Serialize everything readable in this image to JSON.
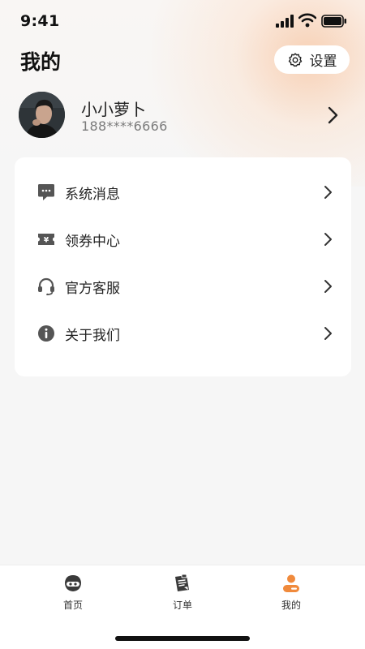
{
  "status_bar": {
    "time": "9:41"
  },
  "header": {
    "title": "我的",
    "settings_label": "设置"
  },
  "profile": {
    "name": "小小萝卜",
    "phone": "188****6666"
  },
  "menu": [
    {
      "label": "系统消息",
      "icon": "message-icon"
    },
    {
      "label": "领券中心",
      "icon": "coupon-icon"
    },
    {
      "label": "官方客服",
      "icon": "headset-icon"
    },
    {
      "label": "关于我们",
      "icon": "info-icon"
    }
  ],
  "tabs": [
    {
      "label": "首页",
      "icon": "home-mascot-icon",
      "active": false
    },
    {
      "label": "订单",
      "icon": "order-icon",
      "active": false
    },
    {
      "label": "我的",
      "icon": "profile-icon",
      "active": true
    }
  ],
  "colors": {
    "accent": "#f08a3c",
    "icon_gray": "#5a5a5a"
  }
}
